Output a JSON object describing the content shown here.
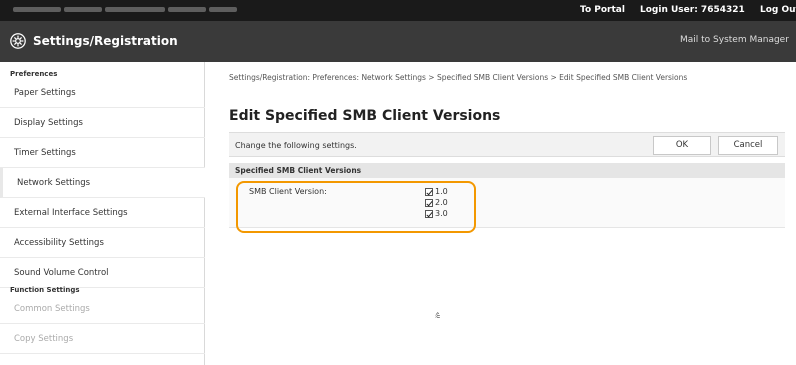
{
  "topbar": {
    "portal": "To Portal",
    "login": "Login User: 7654321",
    "logout": "Log Out"
  },
  "titlebar": {
    "title": "Settings/Registration",
    "mail": "Mail to System Manager",
    "icon": "settings-gear-icon"
  },
  "sidebar": {
    "section1": "Preferences",
    "items1": [
      {
        "label": "Paper Settings"
      },
      {
        "label": "Display Settings"
      },
      {
        "label": "Timer Settings"
      },
      {
        "label": "Network Settings"
      },
      {
        "label": "External Interface Settings"
      },
      {
        "label": "Accessibility Settings"
      },
      {
        "label": "Sound Volume Control"
      }
    ],
    "section2": "Function Settings",
    "items2": [
      {
        "label": "Common Settings"
      },
      {
        "label": "Copy Settings"
      }
    ]
  },
  "main": {
    "breadcrumb": "Settings/Registration: Preferences: Network Settings > Specified SMB Client Versions > Edit Specified SMB Client Versions",
    "heading": "Edit Specified SMB Client Versions",
    "description": "Change the following settings.",
    "ok_label": "OK",
    "cancel_label": "Cancel",
    "section_title": "Specified SMB Client Versions",
    "field_label": "SMB Client Version:",
    "versions": [
      {
        "label": "1.0",
        "checked": true
      },
      {
        "label": "2.0",
        "checked": true
      },
      {
        "label": "3.0",
        "checked": true
      }
    ],
    "to_top": "⩯"
  },
  "colors": {
    "highlight": "#f39800",
    "titlebar": "#3a3a3a",
    "topbar": "#1a1a1a"
  }
}
